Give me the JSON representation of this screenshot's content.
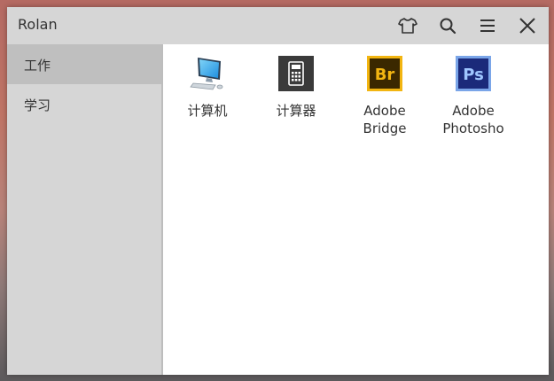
{
  "window": {
    "title": "Rolan"
  },
  "titlebar": {
    "skin_icon": "shirt-icon",
    "search_icon": "search-icon",
    "menu_icon": "hamburger-menu-icon",
    "close_icon": "close-icon"
  },
  "sidebar": {
    "items": [
      {
        "label": "工作",
        "active": true
      },
      {
        "label": "学习",
        "active": false
      }
    ]
  },
  "apps": [
    {
      "label": "计算机",
      "icon": "computer-icon"
    },
    {
      "label": "计算器",
      "icon": "calculator-icon"
    },
    {
      "label": "Adobe\nBridge",
      "icon": "adobe-bridge-icon",
      "icon_text": "Br"
    },
    {
      "label": "Adobe\nPhotosho",
      "icon": "adobe-photoshop-icon",
      "icon_text": "Ps"
    }
  ],
  "colors": {
    "sidebar_bg": "#d6d6d6",
    "sidebar_active": "#bfbfbf",
    "bridge_yellow": "#f2b511",
    "photoshop_blue": "#2b3a8c"
  }
}
